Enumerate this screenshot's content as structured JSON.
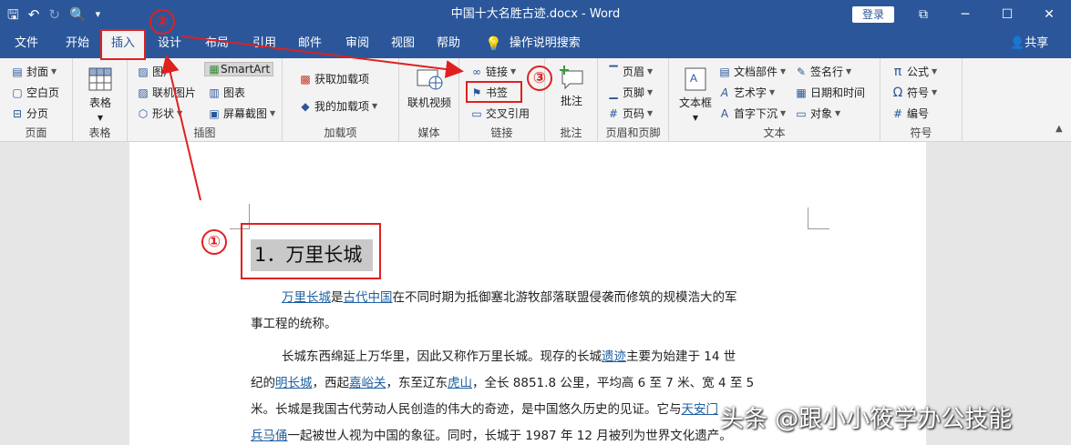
{
  "window": {
    "title": "中国十大名胜古迹.docx  -  Word",
    "login": "登录",
    "controls": [
      "⧉",
      "─",
      "☐",
      "✕"
    ]
  },
  "menu": {
    "tabs": [
      "文件",
      "开始",
      "插入",
      "设计",
      "布局",
      "引用",
      "邮件",
      "审阅",
      "视图",
      "帮助"
    ],
    "active_tab": "插入",
    "tell_me": "操作说明搜索",
    "share": "共享"
  },
  "ribbon": {
    "pages": {
      "label": "页面",
      "cover": "封面",
      "blank": "空白页",
      "break": "分页"
    },
    "tables": {
      "label": "表格",
      "table": "表格"
    },
    "illustrations": {
      "label": "插图",
      "picture": "图片",
      "online_picture": "联机图片",
      "shapes": "形状",
      "smartart": "SmartArt",
      "chart": "图表",
      "screenshot": "屏幕截图"
    },
    "addins": {
      "label": "加载项",
      "get": "获取加载项",
      "my": "我的加载项"
    },
    "media": {
      "label": "媒体",
      "online_video": "联机视频"
    },
    "links": {
      "label": "链接",
      "link": "链接",
      "bookmark": "书签",
      "cross_ref": "交叉引用"
    },
    "comments": {
      "label": "批注",
      "comment": "批注"
    },
    "header_footer": {
      "label": "页眉和页脚",
      "header": "页眉",
      "footer": "页脚",
      "page_number": "页码"
    },
    "text": {
      "label": "文本",
      "textbox": "文本框",
      "doc_parts": "文档部件",
      "wordart": "艺术字",
      "dropcap": "首字下沉",
      "signature": "签名行",
      "datetime": "日期和时间",
      "object": "对象"
    },
    "symbols": {
      "label": "符号",
      "equation": "公式",
      "symbol": "符号",
      "number": "编号"
    }
  },
  "document": {
    "heading": "1．万里长城",
    "p1": {
      "link1": "万里长城",
      "t1": "是",
      "link2": "古代中国",
      "t2": "在不同时期为抵御塞北游牧部落联盟侵袭而修筑的规模浩大的军",
      "t3": "事工程的统称。"
    },
    "p2": {
      "l1a": "长城东西绵延上万华里，因此又称作万里长城。现存的长城",
      "l1link": "遗迹",
      "l1b": "主要为始建于 14 世",
      "l2a": "纪的",
      "l2link1": "明长城",
      "l2b": "，西起",
      "l2link2": "嘉峪关",
      "l2c": "，东至辽东",
      "l2link3": "虎山",
      "l2d": "，全长 8851.8 公里，平均高 6 至 7 米、宽 4 至 5",
      "l3a": "米。长城是我国古代劳动人民创造的伟大的奇迹，是中国悠久历史的见证。它与",
      "l3link": "天安门",
      "l4link": "兵马俑",
      "l4a": "一起被世人视为中国的象征。同时，长城于 1987 年 12 月被列为世界文化遗产。"
    }
  },
  "annotations": {
    "one": "①",
    "two": "②",
    "three": "③"
  },
  "watermark": "头条 @跟小小筱学办公技能",
  "colors": {
    "brand": "#2b579a",
    "annotation": "#e02020",
    "link": "#1f5f9f"
  }
}
